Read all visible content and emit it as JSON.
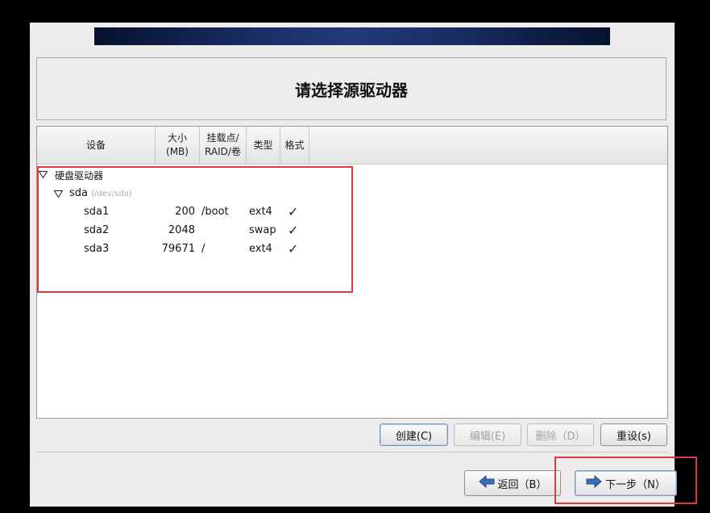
{
  "header": {
    "title": "请选择源驱动器"
  },
  "table": {
    "columns": [
      {
        "label": "设备"
      },
      {
        "label": "大小\n(MB)"
      },
      {
        "label": "挂载点/\nRAID/卷"
      },
      {
        "label": "类型"
      },
      {
        "label": "格式"
      }
    ],
    "group_label": "硬盘驱动器",
    "disk": {
      "name": "sda",
      "path": "(/dev/sda)"
    },
    "partitions": [
      {
        "device": "sda1",
        "size": "200",
        "mount": "/boot",
        "type": "ext4",
        "format": "✓"
      },
      {
        "device": "sda2",
        "size": "2048",
        "mount": "",
        "type": "swap",
        "format": "✓"
      },
      {
        "device": "sda3",
        "size": "79671",
        "mount": "/",
        "type": "ext4",
        "format": "✓"
      }
    ]
  },
  "actions": {
    "create": "创建(C)",
    "edit": "编辑(E)",
    "delete": "删除（D）",
    "reset": "重设(s)"
  },
  "nav": {
    "back": "返回（B）",
    "next": "下一步（N）"
  },
  "colors": {
    "annotation": "#e0393b",
    "arrow": "#3a6fb5"
  }
}
